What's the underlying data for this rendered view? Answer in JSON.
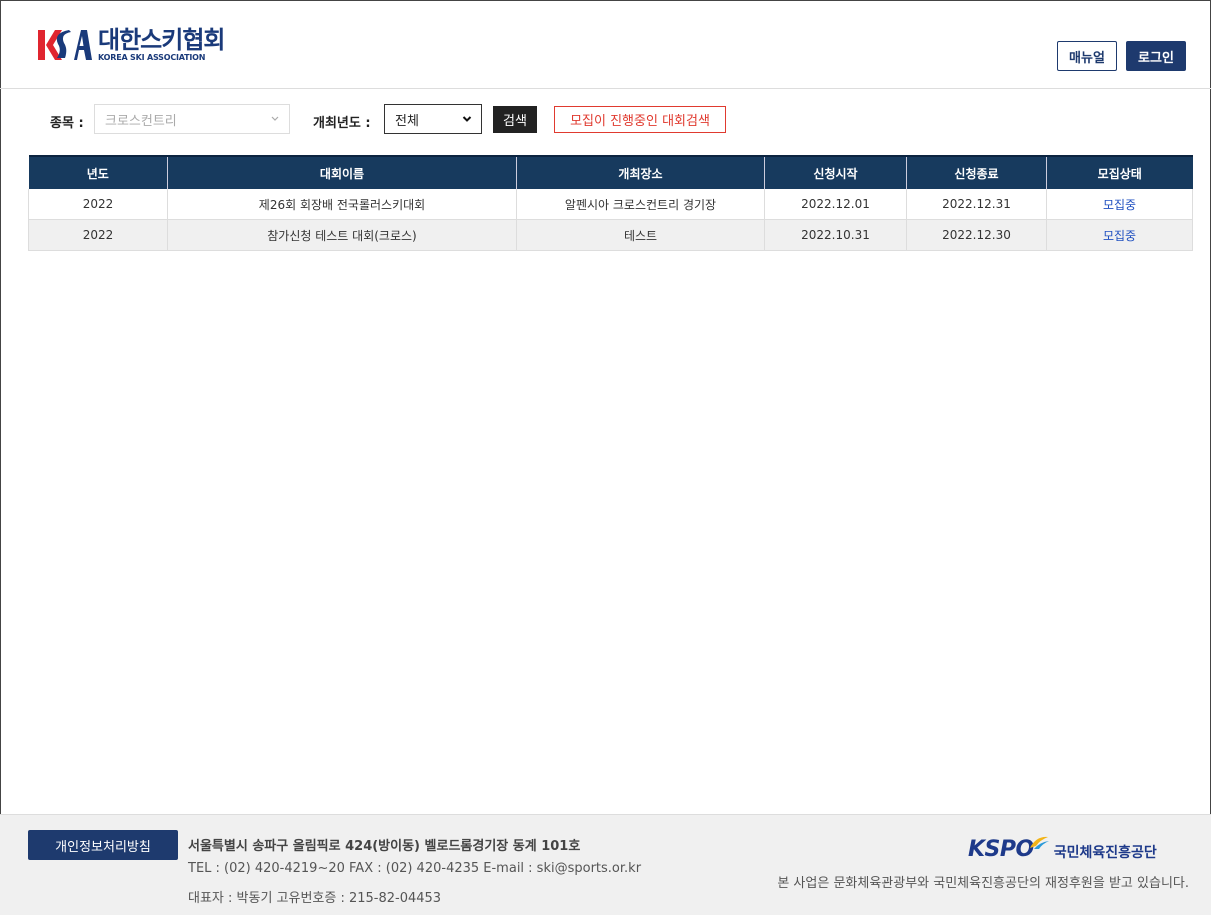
{
  "header": {
    "logo_mark": "KSA",
    "logo_ko": "대한스키협회",
    "logo_en": "KOREA SKI ASSOCIATION",
    "manual_label": "매뉴얼",
    "login_label": "로그인"
  },
  "search": {
    "sport_label": "종목 :",
    "sport_value": "크로스컨트리",
    "year_label": "개최년도 :",
    "year_value": "전체",
    "search_label": "검색",
    "recruiting_label": "모집이 진행중인 대회검색"
  },
  "table": {
    "headers": [
      "년도",
      "대회이름",
      "개최장소",
      "신청시작",
      "신청종료",
      "모집상태"
    ],
    "rows": [
      [
        "2022",
        "제26회 회장배 전국롤러스키대회",
        "알펜시아 크로스컨트리 경기장",
        "2022.12.01",
        "2022.12.31",
        "모집중"
      ],
      [
        "2022",
        "참가신청 테스트 대회(크로스)",
        "테스트",
        "2022.10.31",
        "2022.12.30",
        "모집중"
      ]
    ]
  },
  "footer": {
    "privacy_label": "개인정보처리방침",
    "address": "서울특별시 송파구 올림픽로 424(방이동) 벨로드롬경기장 동계 101호",
    "contact": "TEL : (02) 420-4219~20   FAX : (02) 420-4235   E-mail : ski@sports.or.kr",
    "rep": "대표자 : 박동기   고유번호증 : 215-82-04453",
    "kspo_en": "KSPO",
    "kspo_ko": "국민체육진흥공단",
    "sponsor": "본 사업은 문화체육관광부와 국민체육진흥공단의 재정후원을 받고 있습니다."
  },
  "colors": {
    "brand_navy": "#1e3a6e",
    "table_header": "#173a5e",
    "logo_red": "#e0252f",
    "status_link": "#2050c0",
    "recruit_red": "#e03a2f"
  }
}
